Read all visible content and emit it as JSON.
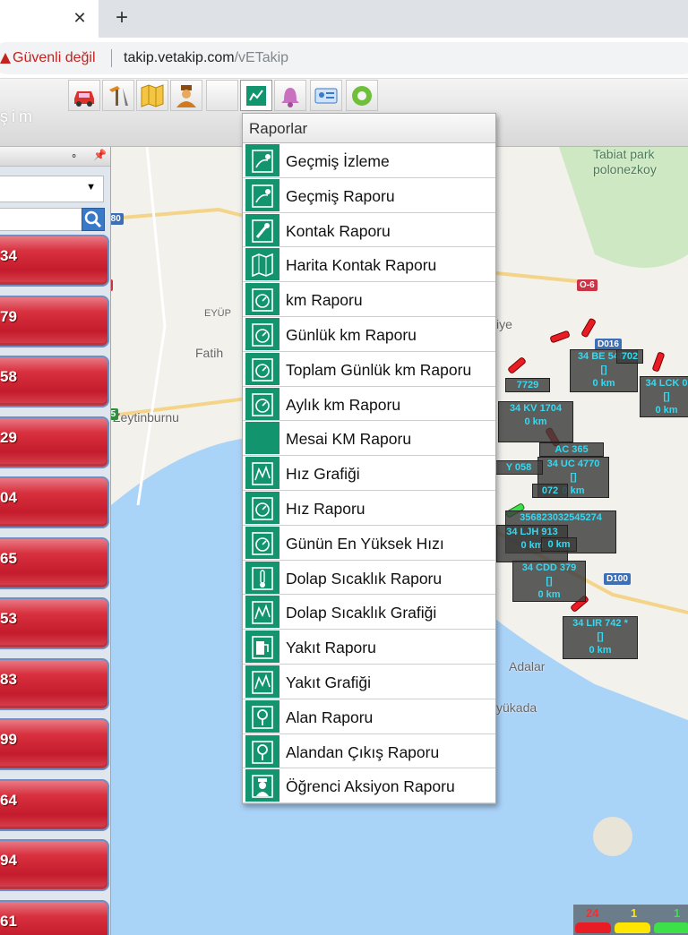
{
  "browser": {
    "security_label": "Güvenli değil",
    "url_host": "takip.vetakip.com",
    "url_path": "/vETakip"
  },
  "app": {
    "brand_text": "şim",
    "toolbar": [
      "car-icon",
      "tools-icon",
      "map-icon",
      "driver-icon",
      "blank",
      "report-icon",
      "alarm-bell-icon",
      "id-card-icon",
      "gear-icon"
    ]
  },
  "vehicle_list": [
    "34",
    "79",
    "58",
    "29",
    "04",
    "65",
    "53",
    "83",
    "99",
    "64",
    "94",
    "61"
  ],
  "map": {
    "place_labels": {
      "park": "Tabiat park\npolonezkoy",
      "eyup": "EYÜP",
      "fatih": "Fatih",
      "zeytinburnu": "Zeytinburnu",
      "adalar": "Adalar",
      "buyukada": "yükada",
      "iye": "iye"
    },
    "road_shields": {
      "e80": "E80",
      "e5": "E5",
      "o6": "O-6",
      "d016": "D016",
      "d100": "D100",
      "num3": "3"
    },
    "vehicle_boxes": [
      {
        "line1": "34 BE 5484",
        "line2": "[]",
        "line3": "0 km"
      },
      {
        "line1": "34 LCK 0",
        "line2": "[]",
        "line3": "0 km"
      },
      {
        "line1": "34 KV 1704",
        "line2": "",
        "line3": "0 km"
      },
      {
        "line1": "34 UC 4770",
        "line2": "[]",
        "line3": "0 km"
      },
      {
        "line1": "356823032545274",
        "line2": "",
        "line3": ""
      },
      {
        "line1": "34 LJH 913",
        "line2": "",
        "line3": "0 km"
      },
      {
        "line1": "34 CDD 379",
        "line2": "[]",
        "line3": "0 km"
      },
      {
        "line1": "34 LIR 742 *",
        "line2": "[]",
        "line3": "0 km"
      }
    ],
    "fragments": {
      "f1": "702",
      "f2": "7729",
      "f3": "AC 365",
      "f4": "Y 058",
      "f5": "072",
      "f6": "0 km"
    }
  },
  "status_summary": {
    "red": "24",
    "yellow": "1",
    "green": "1",
    "colors": {
      "red": "#e81c24",
      "yellow": "#ffe600",
      "green": "#3ee04a"
    }
  },
  "menu": {
    "title": "Raporlar",
    "items": [
      {
        "label": "Geçmiş İzleme",
        "icon": "route-history-icon"
      },
      {
        "label": "Geçmiş Raporu",
        "icon": "route-report-icon"
      },
      {
        "label": "Kontak Raporu",
        "icon": "ignition-icon"
      },
      {
        "label": "Harita Kontak Raporu",
        "icon": "map-ignition-icon"
      },
      {
        "label": "km Raporu",
        "icon": "odometer-icon"
      },
      {
        "label": "Günlük km Raporu",
        "icon": "odometer-icon"
      },
      {
        "label": "Toplam Günlük km Raporu",
        "icon": "odometer-icon"
      },
      {
        "label": "Aylık km Raporu",
        "icon": "odometer-icon"
      },
      {
        "label": "Mesai KM Raporu",
        "icon": "none"
      },
      {
        "label": "Hız Grafiği",
        "icon": "speed-chart-icon"
      },
      {
        "label": "Hız Raporu",
        "icon": "odometer-icon"
      },
      {
        "label": "Günün En Yüksek Hızı",
        "icon": "odometer-icon"
      },
      {
        "label": "Dolap Sıcaklık Raporu",
        "icon": "thermometer-icon"
      },
      {
        "label": "Dolap Sıcaklık Grafiği",
        "icon": "temperature-chart-icon"
      },
      {
        "label": "Yakıt Raporu",
        "icon": "fuel-pump-icon"
      },
      {
        "label": "Yakıt Grafiği",
        "icon": "fuel-chart-icon"
      },
      {
        "label": "Alan Raporu",
        "icon": "area-icon"
      },
      {
        "label": "Alandan Çıkış Raporu",
        "icon": "area-exit-icon"
      },
      {
        "label": "Öğrenci Aksiyon Raporu",
        "icon": "student-icon"
      }
    ]
  }
}
